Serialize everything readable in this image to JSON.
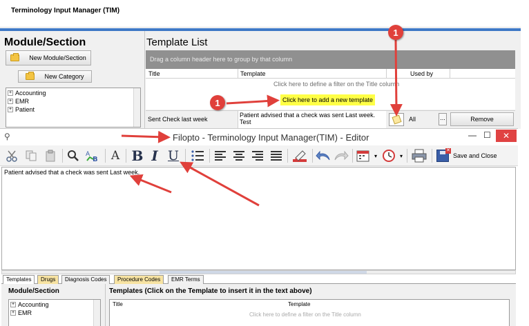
{
  "app": {
    "title": "Terminology Input Manager (TIM)"
  },
  "module_panel": {
    "header": "Module/Section",
    "new_module_label": "New Module/Section",
    "new_category_label": "New Category",
    "tree": [
      "Accounting",
      "EMR",
      "Patient"
    ]
  },
  "template_list": {
    "header": "Template List",
    "group_hint": "Drag a column header here to group by that column",
    "columns": {
      "title": "Title",
      "template": "Template",
      "used_by": "Used by"
    },
    "filter_hint": "Click here to define a filter on the Title column",
    "new_template_label": "Click here to add a new template",
    "row": {
      "title": "Sent Check last week",
      "template_line1": "Patient advised that a check was sent Last week.",
      "template_line2": "Test",
      "used_by": "All",
      "dots": "...",
      "remove_label": "Remove"
    }
  },
  "editor": {
    "title": "Filopto - Terminology Input Manager(TIM) - Editor",
    "minimize": "—",
    "maximize": "☐",
    "close": "✕",
    "save_close_label": "Save and Close",
    "text": "Patient advised that a check was sent Last week.",
    "toolbar_glyphs": {
      "font": "A",
      "bold": "B",
      "italic": "I",
      "underline": "U"
    }
  },
  "tabs": [
    {
      "label": "Templates",
      "active": true
    },
    {
      "label": "Drugs",
      "active": false
    },
    {
      "label": "Diagnosis Codes",
      "active": false
    },
    {
      "label": "Procedure Codes",
      "active": false
    },
    {
      "label": "EMR Terms",
      "active": false
    }
  ],
  "lower": {
    "module_header": "Module/Section",
    "templates_header": "Templates   (Click on the Template to insert it in the text above)",
    "tree": [
      "Accounting",
      "EMR"
    ],
    "columns": {
      "title": "Title",
      "template": "Template"
    },
    "faint_hint": "Click here to define a filter on the Title column"
  },
  "annotations": {
    "badge_top": "1",
    "badge_left": "1"
  },
  "colors": {
    "arrow": "#e0403b",
    "highlight": "#ffff46",
    "accent": "#3e78c6"
  }
}
